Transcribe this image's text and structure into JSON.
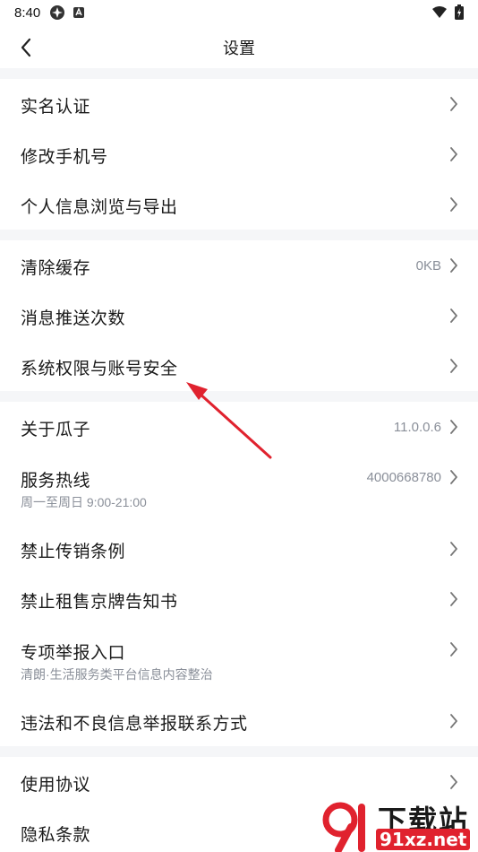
{
  "status_bar": {
    "time": "8:40"
  },
  "nav": {
    "title": "设置"
  },
  "sections": [
    [
      {
        "title": "实名认证"
      },
      {
        "title": "修改手机号"
      },
      {
        "title": "个人信息浏览与导出"
      }
    ],
    [
      {
        "title": "清除缓存",
        "value": "0KB"
      },
      {
        "title": "消息推送次数"
      },
      {
        "title": "系统权限与账号安全"
      }
    ],
    [
      {
        "title": "关于瓜子",
        "value": "11.0.0.6"
      },
      {
        "title": "服务热线",
        "value": "4000668780",
        "subtitle": "周一至周日 9:00-21:00"
      },
      {
        "title": "禁止传销条例"
      },
      {
        "title": "禁止租售京牌告知书"
      },
      {
        "title": "专项举报入口",
        "subtitle": "清朗·生活服务类平台信息内容整治"
      },
      {
        "title": "违法和不良信息举报联系方式"
      }
    ],
    [
      {
        "title": "使用协议"
      },
      {
        "title": "隐私条款"
      }
    ]
  ],
  "watermark": {
    "main": "下载站",
    "url": "91xz.net"
  },
  "colors": {
    "accent_arrow": "#e0222e",
    "section_bg": "#f5f6f8",
    "muted_text": "#8a8f99"
  }
}
